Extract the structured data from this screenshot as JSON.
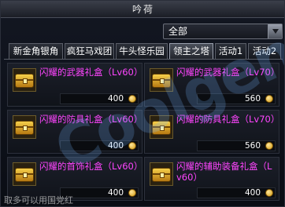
{
  "window": {
    "title": "吟荷"
  },
  "filter": {
    "selected": "全部"
  },
  "tabs": [
    {
      "label": "新金角银角"
    },
    {
      "label": "疯狂马戏团"
    },
    {
      "label": "牛头怪乐园"
    },
    {
      "label": "领主之塔"
    },
    {
      "label": "活动1"
    },
    {
      "label": "活动2"
    }
  ],
  "active_tab": "领主之塔",
  "items": [
    {
      "name": "闪耀的武器礼盒（Lv60）",
      "price": "400"
    },
    {
      "name": "闪耀的武器礼盒（Lv70）",
      "price": "560"
    },
    {
      "name": "闪耀的防具礼盒（Lv60）",
      "price": "400"
    },
    {
      "name": "闪耀的防具礼盒（Lv70）",
      "price": "560"
    },
    {
      "name": "闪耀的首饰礼盒（Lv60）",
      "price": "400"
    },
    {
      "name": "闪耀的辅助装备礼盒（Lv60）",
      "price": "400"
    }
  ],
  "watermark": "Coolgen",
  "footer_partial": "取多可以用国党红"
}
